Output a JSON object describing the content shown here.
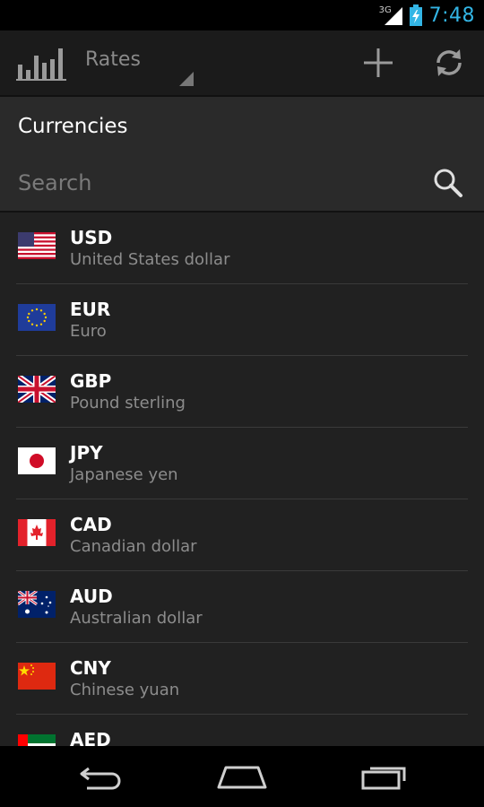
{
  "status_bar": {
    "network": "3G",
    "time": "7:48",
    "accent_color": "#33b5e5"
  },
  "action_bar": {
    "spinner_label": "Rates",
    "icons": [
      "bar-chart-icon",
      "add-icon",
      "refresh-icon"
    ]
  },
  "panel": {
    "title": "Currencies",
    "search_placeholder": "Search"
  },
  "currencies": [
    {
      "code": "USD",
      "name": "United States dollar",
      "flag": "us-flag-icon"
    },
    {
      "code": "EUR",
      "name": "Euro",
      "flag": "eu-flag-icon"
    },
    {
      "code": "GBP",
      "name": "Pound sterling",
      "flag": "uk-flag-icon"
    },
    {
      "code": "JPY",
      "name": "Japanese yen",
      "flag": "japan-flag-icon"
    },
    {
      "code": "CAD",
      "name": "Canadian dollar",
      "flag": "canada-flag-icon"
    },
    {
      "code": "AUD",
      "name": "Australian dollar",
      "flag": "australia-flag-icon"
    },
    {
      "code": "CNY",
      "name": "Chinese yuan",
      "flag": "china-flag-icon"
    },
    {
      "code": "AED",
      "name": "",
      "flag": "uae-flag-icon"
    }
  ],
  "nav_bar": {
    "buttons": [
      "back-icon",
      "home-icon",
      "recent-apps-icon"
    ]
  }
}
